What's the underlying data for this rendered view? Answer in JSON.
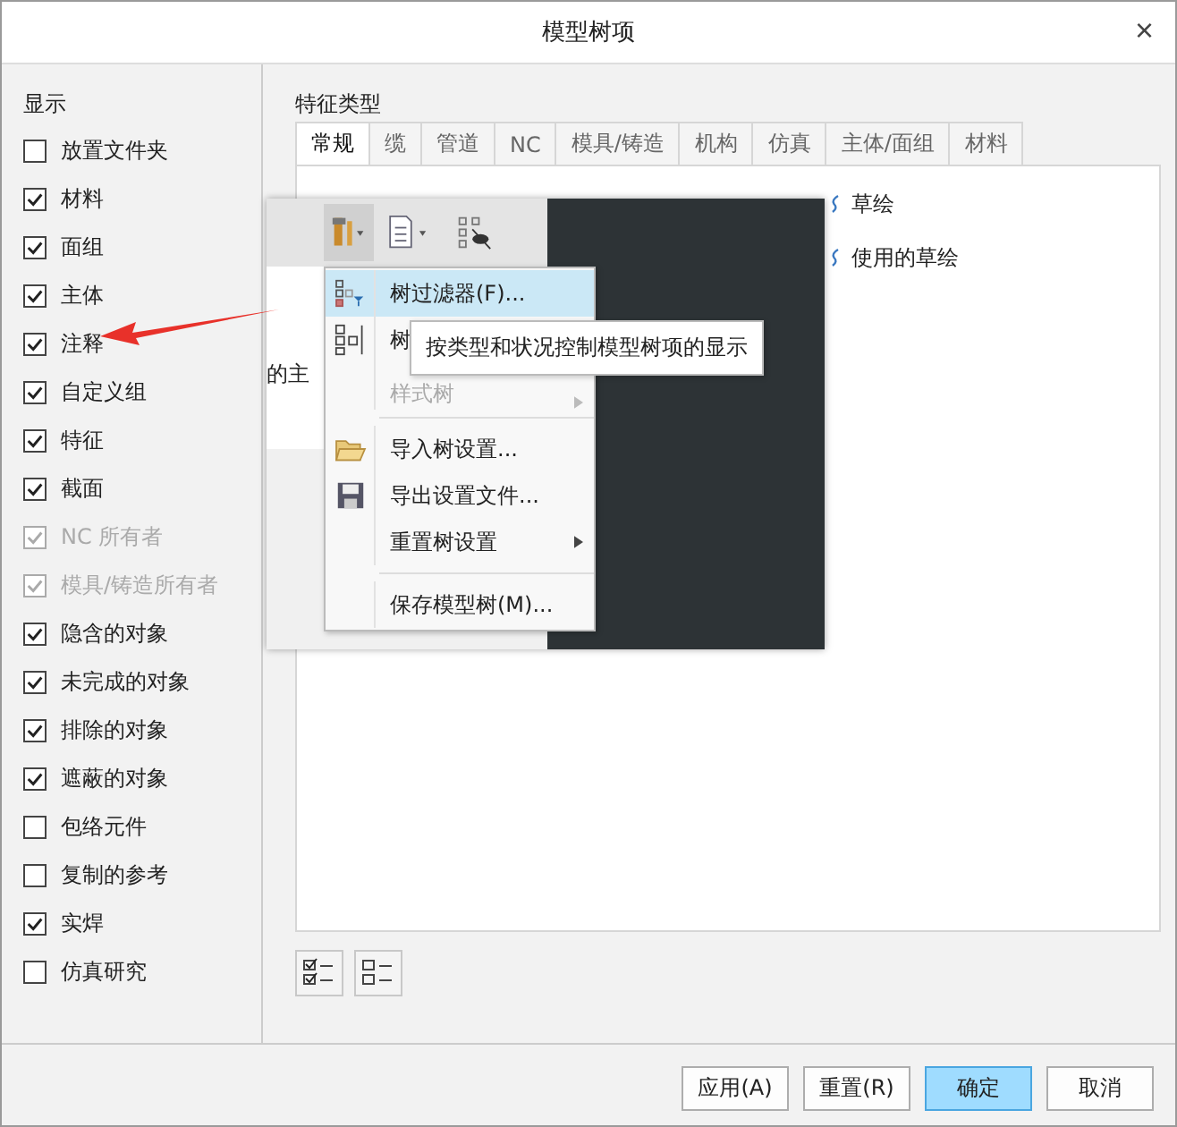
{
  "window": {
    "title": "模型树项",
    "close": "×"
  },
  "display": {
    "title": "显示",
    "items": [
      {
        "label": "放置文件夹",
        "checked": false,
        "disabled": false
      },
      {
        "label": "材料",
        "checked": true,
        "disabled": false
      },
      {
        "label": "面组",
        "checked": true,
        "disabled": false
      },
      {
        "label": "主体",
        "checked": true,
        "disabled": false
      },
      {
        "label": "注释",
        "checked": true,
        "disabled": false
      },
      {
        "label": "自定义组",
        "checked": true,
        "disabled": false
      },
      {
        "label": "特征",
        "checked": true,
        "disabled": false
      },
      {
        "label": "截面",
        "checked": true,
        "disabled": false
      },
      {
        "label": "NC 所有者",
        "checked": true,
        "disabled": true
      },
      {
        "label": "模具/铸造所有者",
        "checked": true,
        "disabled": true
      },
      {
        "label": "隐含的对象",
        "checked": true,
        "disabled": false
      },
      {
        "label": "未完成的对象",
        "checked": true,
        "disabled": false
      },
      {
        "label": "排除的对象",
        "checked": true,
        "disabled": false
      },
      {
        "label": "遮蔽的对象",
        "checked": true,
        "disabled": false
      },
      {
        "label": "包络元件",
        "checked": false,
        "disabled": false
      },
      {
        "label": "复制的参考",
        "checked": false,
        "disabled": false
      },
      {
        "label": "实焊",
        "checked": true,
        "disabled": false
      },
      {
        "label": "仿真研究",
        "checked": false,
        "disabled": false
      }
    ]
  },
  "feature_types": {
    "title": "特征类型",
    "tabs": [
      {
        "label": "常规",
        "selected": true
      },
      {
        "label": "缆",
        "selected": false
      },
      {
        "label": "管道",
        "selected": false
      },
      {
        "label": "NC",
        "selected": false
      },
      {
        "label": "模具/铸造",
        "selected": false
      },
      {
        "label": "机构",
        "selected": false
      },
      {
        "label": "仿真",
        "selected": false
      },
      {
        "label": "主体/面组",
        "selected": false
      },
      {
        "label": "材料",
        "selected": false
      }
    ],
    "items": [
      "草绘",
      "使用的草绘"
    ]
  },
  "inset": {
    "partial_text": "的主",
    "menu": [
      {
        "kind": "item",
        "label": "树过滤器(F)...",
        "selected": true,
        "disabled": false,
        "submenu": false
      },
      {
        "kind": "item",
        "label": "树",
        "selected": false,
        "disabled": false
      },
      {
        "kind": "item",
        "label": "样式树",
        "selected": false,
        "disabled": true,
        "submenu": true
      },
      {
        "kind": "separator"
      },
      {
        "kind": "item",
        "label": "导入树设置...",
        "selected": false,
        "disabled": false,
        "submenu": false
      },
      {
        "kind": "item",
        "label": "导出设置文件...",
        "selected": false,
        "disabled": false,
        "submenu": false
      },
      {
        "kind": "item",
        "label": "重置树设置",
        "selected": false,
        "disabled": false,
        "submenu": true
      },
      {
        "kind": "separator"
      },
      {
        "kind": "item",
        "label": "保存模型树(M)...",
        "selected": false,
        "disabled": false,
        "submenu": false
      }
    ],
    "tooltip": "按类型和状况控制模型树项的显示"
  },
  "buttons": [
    {
      "label": "应用(A)",
      "default": false
    },
    {
      "label": "重置(R)",
      "default": false
    },
    {
      "label": "确定",
      "default": true
    },
    {
      "label": "取消",
      "default": false
    }
  ]
}
